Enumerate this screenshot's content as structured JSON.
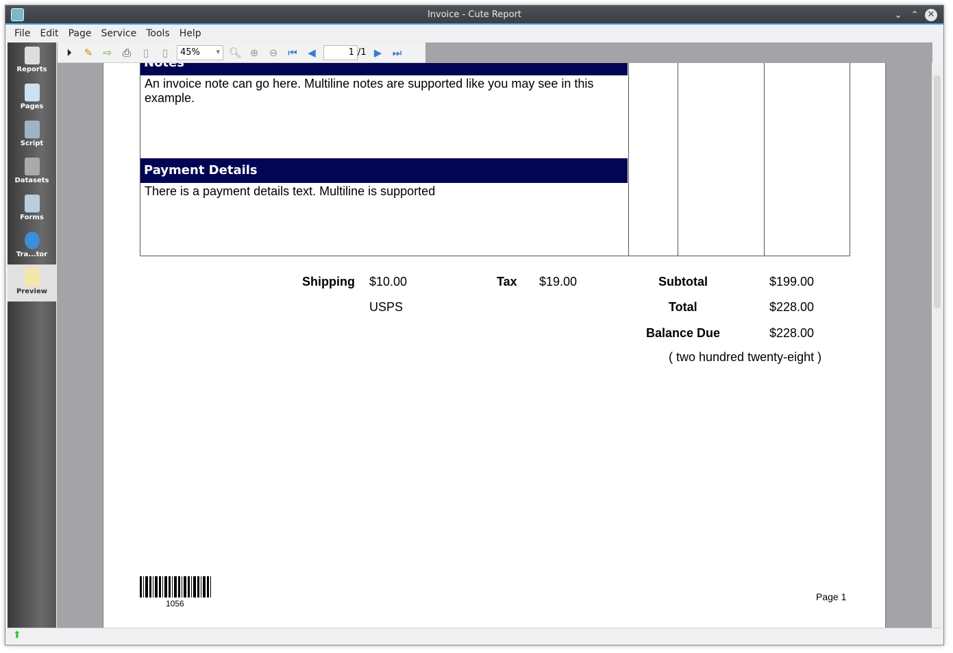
{
  "window": {
    "title": "Invoice - Cute Report"
  },
  "menu": [
    "File",
    "Edit",
    "Page",
    "Service",
    "Tools",
    "Help"
  ],
  "sidebar": [
    {
      "label": "Reports",
      "color": "#ddd"
    },
    {
      "label": "Pages",
      "color": "#cfe0f5"
    },
    {
      "label": "Script",
      "color": "#9fb3c8"
    },
    {
      "label": "Datasets",
      "color": "#aaa"
    },
    {
      "label": "Forms",
      "color": "#bcd"
    },
    {
      "label": "Tra...tor",
      "color": "#3a8fd6"
    },
    {
      "label": "Preview",
      "color": "#f5e7a8"
    }
  ],
  "toolbar": {
    "zoom": "45%",
    "page_current": "1",
    "page_total": "/1"
  },
  "invoice": {
    "notes_header": "Notes",
    "notes_text": "An invoice note can go here. Multiline notes are supported like you may see in this example.",
    "payment_header": "Payment Details",
    "payment_text": "There is a payment details text. Multiline is supported",
    "shipping_label": "Shipping",
    "shipping_value": "$10.00",
    "shipping_method": "USPS",
    "tax_label": "Tax",
    "tax_value": "$19.00",
    "subtotal_label": "Subtotal",
    "subtotal_value": "$199.00",
    "total_label": "Total",
    "total_value": "$228.00",
    "balance_label": "Balance Due",
    "balance_value": "$228.00",
    "amount_words": "( two hundred twenty-eight  )",
    "barcode_number": "1056",
    "page_label": "Page 1"
  }
}
